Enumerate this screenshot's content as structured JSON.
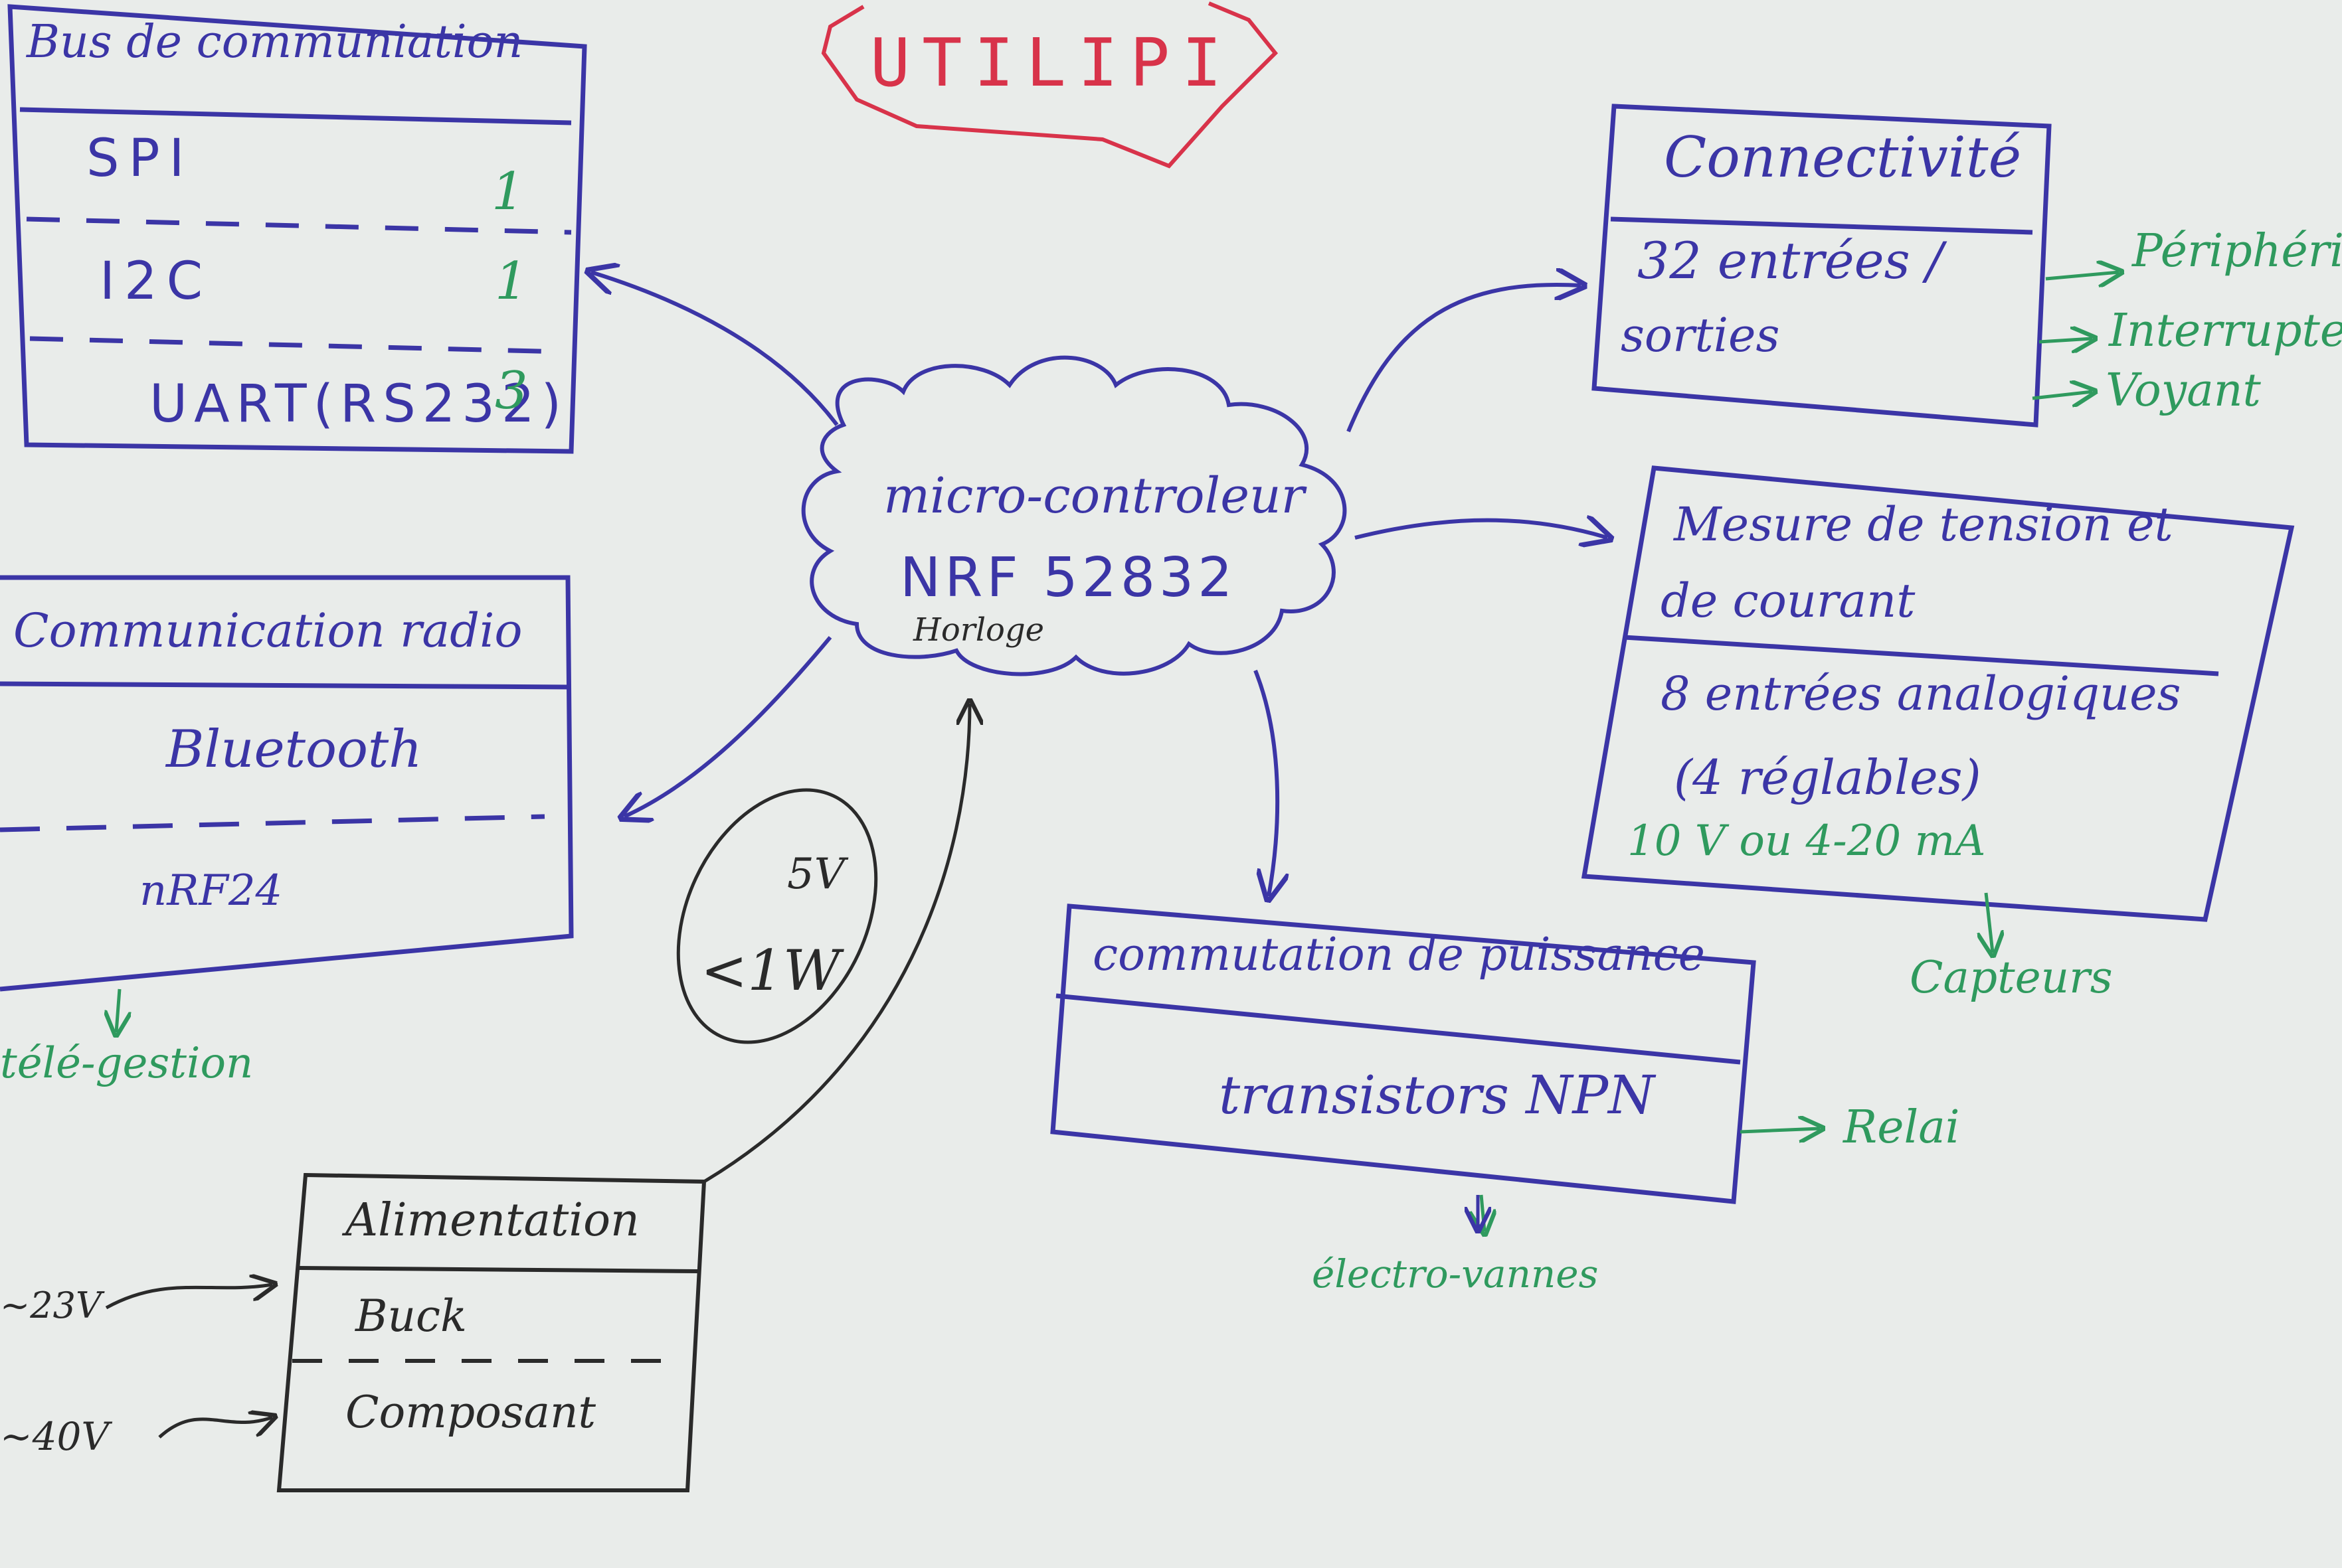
{
  "title": "UTILIPI",
  "center": {
    "line1": "micro-controleur",
    "line2": "NRF 52832",
    "line3": "Horloge"
  },
  "bus": {
    "title": "Bus de communiation",
    "rows": [
      {
        "label": "SPI",
        "count": "1"
      },
      {
        "label": "I2C",
        "count": "1"
      },
      {
        "label": "UART(RS232)",
        "count": "3"
      }
    ]
  },
  "radio": {
    "title": "Communication radio",
    "items": [
      "Bluetooth",
      "nRF24"
    ],
    "output": "télé-gestion"
  },
  "connectivity": {
    "title": "Connectivité",
    "body_line1": "32 entrées /",
    "body_line2": "sorties",
    "outputs": [
      "Périphéri",
      "Interrupte",
      "Voyant"
    ]
  },
  "measure": {
    "title_line1": "Mesure de tension et",
    "title_line2": "de courant",
    "body_line1": "8 entrées analogiques",
    "body_line2": "(4 réglables)",
    "range": "10 V ou 4-20 mA",
    "output": "Capteurs"
  },
  "power_switch": {
    "title": "commutation de puissance",
    "body": "transistors NPN",
    "output_right": "Relai",
    "output_down": "électro-vannes"
  },
  "supply": {
    "title": "Alimentation",
    "rows": [
      "Buck",
      "Composant"
    ],
    "inputs": [
      "~23V",
      "~40V"
    ]
  },
  "supply_note": {
    "line1": "5V",
    "line2": "<1W"
  },
  "colors": {
    "ink_blue": "#3b35a6",
    "ink_green": "#2f9a5e",
    "ink_red": "#d8334a",
    "ink_black": "#2a2a2a",
    "paper": "#e9ecea"
  }
}
